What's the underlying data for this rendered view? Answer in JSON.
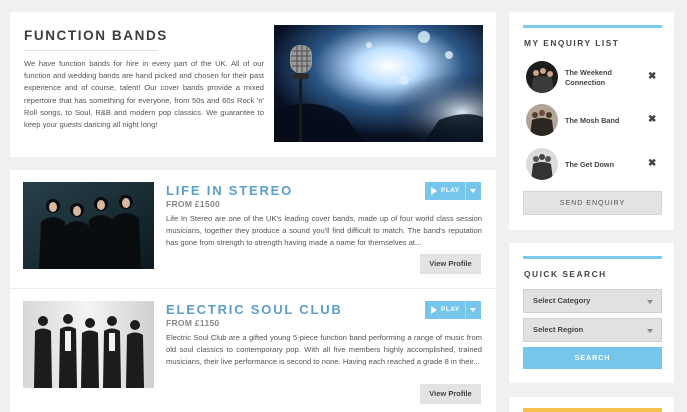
{
  "intro": {
    "title": "FUNCTION BANDS",
    "text": "We have function bands for hire in every part of the UK. All of our function and wedding bands are hand picked and chosen for their past experience and of course, talent! Our cover bands provide a mixed repertoire that has something for everyone, from 50s and 60s Rock 'n' Roll songs, to Soul, R&B and modern pop classics. We guarantee to keep your guests dancing all night long!",
    "image_icon": "microphone-stage-photo"
  },
  "bands": [
    {
      "name": "LIFE IN STEREO",
      "price": "FROM £1500",
      "description": "Life In Stereo are one of the UK's leading cover bands, made up of four world class session musicians, together they produce a sound you'll find difficult to match. The band's reputation has gone from strength to strength having made a name for themselves at...",
      "play_label": "PLAY",
      "view_label": "View Profile"
    },
    {
      "name": "ELECTRIC SOUL CLUB",
      "price": "FROM £1150",
      "description": "Electric Soul Club are a gifted young 5-piece function band performing a range of music from old soul classics to contemporary pop. With all five members highly accomplished, trained musicians, their live performance is second to none. Having each reached a grade 8 in their...",
      "play_label": "PLAY",
      "view_label": "View Profile"
    }
  ],
  "enquiry": {
    "title": "MY ENQUIRY LIST",
    "items": [
      {
        "name": "The Weekend Connection",
        "remove": "✖"
      },
      {
        "name": "The Mosh Band",
        "remove": "✖"
      },
      {
        "name": "The Get Down",
        "remove": "✖"
      }
    ],
    "send_label": "SEND ENQUIRY"
  },
  "quick_search": {
    "title": "QUICK SEARCH",
    "category": "Select Category",
    "region": "Select Region",
    "search_label": "SEARCH"
  },
  "colors": {
    "accent_blue": "#76c6ec",
    "band_name_blue": "#5b9ec9",
    "bar_yellow": "#f5c14a"
  }
}
